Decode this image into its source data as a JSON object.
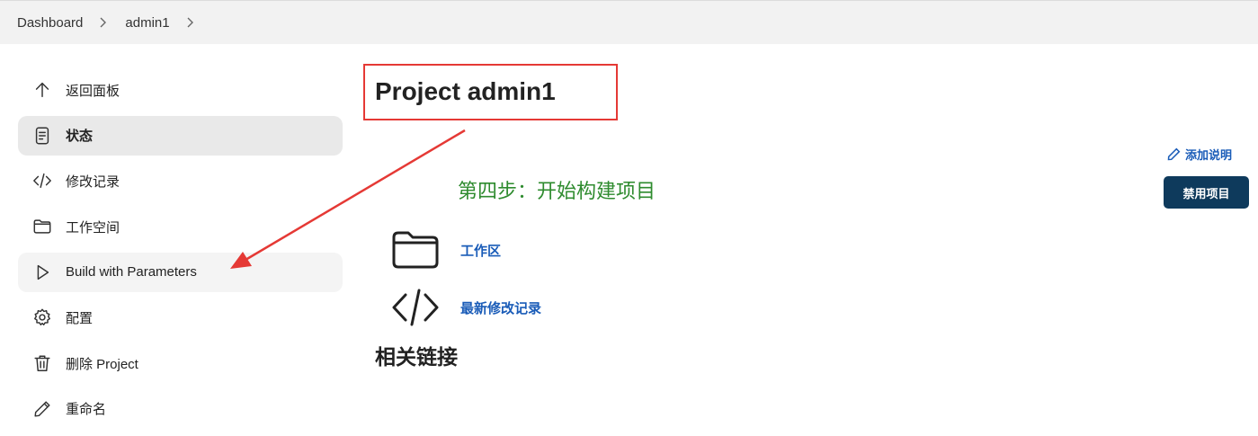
{
  "breadcrumb": {
    "items": [
      "Dashboard",
      "admin1"
    ]
  },
  "sidebar": {
    "items": [
      {
        "label": "返回面板",
        "icon": "arrow-up-icon"
      },
      {
        "label": "状态",
        "icon": "document-icon"
      },
      {
        "label": "修改记录",
        "icon": "code-icon"
      },
      {
        "label": "工作空间",
        "icon": "folder-icon"
      },
      {
        "label": "Build with Parameters",
        "icon": "play-icon"
      },
      {
        "label": "配置",
        "icon": "gear-icon"
      },
      {
        "label": "删除 Project",
        "icon": "trash-icon"
      },
      {
        "label": "重命名",
        "icon": "pencil-icon"
      }
    ]
  },
  "main": {
    "title": "Project admin1",
    "add_description": "添加说明",
    "disable_button": "禁用项目",
    "annotation": "第四步：开始构建项目",
    "links": [
      {
        "label": "工作区",
        "icon": "folder-icon"
      },
      {
        "label": "最新修改记录",
        "icon": "code-icon"
      }
    ],
    "section_title": "相关链接"
  },
  "colors": {
    "annotation_box": "#e53935",
    "annotation_text": "#2e8b2e",
    "link": "#1a5cb8",
    "primary_button": "#0e3a5c",
    "active_item_bg": "#e9e9e9"
  }
}
